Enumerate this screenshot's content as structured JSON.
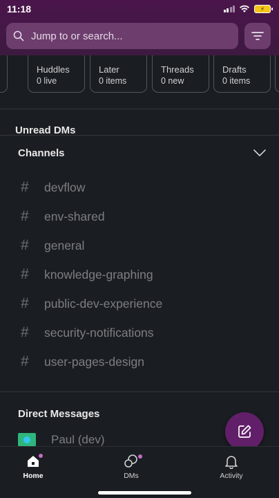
{
  "status": {
    "time": "11:18"
  },
  "search": {
    "placeholder": "Jump to or search..."
  },
  "cards": [
    {
      "title": "Huddles",
      "sub": "0 live"
    },
    {
      "title": "Later",
      "sub": "0 items"
    },
    {
      "title": "Threads",
      "sub": "0 new"
    },
    {
      "title": "Drafts",
      "sub": "0 items"
    }
  ],
  "unread_dms": {
    "label": "Unread DMs"
  },
  "channels": {
    "header": "Channels",
    "items": [
      "devflow",
      "env-shared",
      "general",
      "knowledge-graphing",
      "public-dev-experience",
      "security-notifications",
      "user-pages-design"
    ]
  },
  "direct_messages": {
    "header": "Direct Messages",
    "items": [
      "Paul (dev)"
    ]
  },
  "tabs": [
    {
      "label": "Home",
      "active": true
    },
    {
      "label": "DMs",
      "active": false
    },
    {
      "label": "Activity",
      "active": false
    }
  ],
  "colors": {
    "brand": "#4a154b",
    "background": "#1a1d21",
    "accent_dot": "#c66ac9"
  }
}
